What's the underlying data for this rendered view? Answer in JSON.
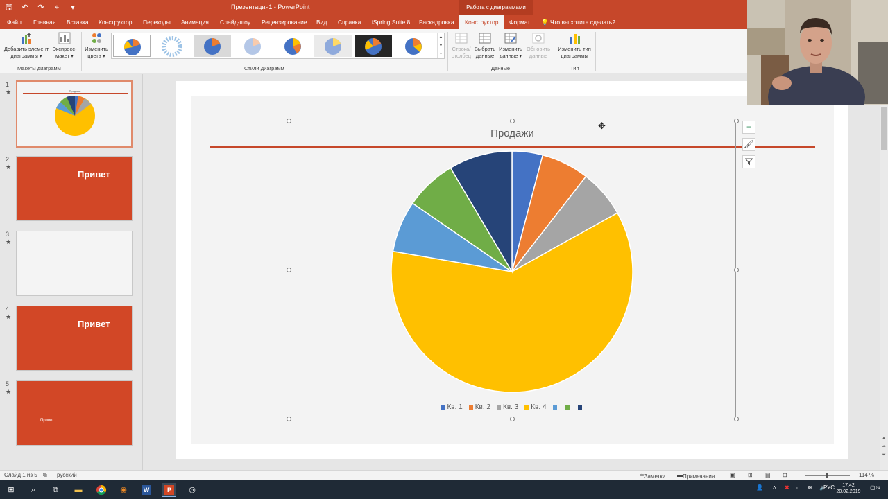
{
  "window": {
    "title": "Презентация1  -  PowerPoint",
    "context_group": "Работа с диаграммами",
    "qat_icons": [
      "save-icon",
      "undo-icon",
      "redo-icon",
      "touch-mode-icon",
      "customize-icon"
    ]
  },
  "tabs": [
    {
      "label": "Файл"
    },
    {
      "label": "Главная"
    },
    {
      "label": "Вставка"
    },
    {
      "label": "Конструктор"
    },
    {
      "label": "Переходы"
    },
    {
      "label": "Анимация"
    },
    {
      "label": "Слайд-шоу"
    },
    {
      "label": "Рецензирование"
    },
    {
      "label": "Вид"
    },
    {
      "label": "Справка"
    },
    {
      "label": "iSpring Suite 8"
    },
    {
      "label": "Раскадровка"
    },
    {
      "label": "Конструктор"
    },
    {
      "label": "Формат"
    }
  ],
  "tell_me": "Что вы хотите сделать?",
  "ribbon": {
    "add_element": "Добавить элемент диаграммы",
    "add_element_l1": "Добавить элемент",
    "add_element_l2": "диаграммы ▾",
    "quick_layout_l1": "Экспресс-",
    "quick_layout_l2": "макет ▾",
    "change_colors_l1": "Изменить",
    "change_colors_l2": "цвета ▾",
    "group_layouts": "Макеты диаграмм",
    "group_styles": "Стили диаграмм",
    "switch_row_l1": "Строка/",
    "switch_row_l2": "столбец",
    "select_data_l1": "Выбрать",
    "select_data_l2": "данные",
    "edit_data_l1": "Изменить",
    "edit_data_l2": "данные ▾",
    "refresh_data_l1": "Обновить",
    "refresh_data_l2": "данные",
    "group_data": "Данные",
    "change_type_l1": "Изменить тип",
    "change_type_l2": "диаграммы",
    "group_type": "Тип"
  },
  "slides": [
    {
      "num": "1",
      "star": "★",
      "text": ""
    },
    {
      "num": "2",
      "star": "★",
      "text": "Привет"
    },
    {
      "num": "3",
      "star": "★",
      "text": ""
    },
    {
      "num": "4",
      "star": "★",
      "text": "Привет"
    },
    {
      "num": "5",
      "star": "★",
      "text": "Привет"
    }
  ],
  "thumb1_title": "Продажи",
  "colors": {
    "accent": "#c6472a",
    "slide_red": "#d24726",
    "series": [
      "#4472c4",
      "#ed7d31",
      "#a5a5a5",
      "#ffc000",
      "#5b9bd5",
      "#70ad47",
      "#264478"
    ]
  },
  "chart_data": {
    "type": "pie",
    "title": "Продажи",
    "categories": [
      "Кв. 1",
      "Кв. 2",
      "Кв. 3",
      "Кв. 4",
      "",
      "",
      ""
    ],
    "values": [
      4.1,
      6.4,
      6.4,
      60.8,
      6.9,
      6.9,
      8.5
    ],
    "legend": "bottom"
  },
  "status": {
    "slide_count": "Слайд 1 из 5",
    "language": "русский",
    "notes": "Заметки",
    "comments": "Примечания",
    "zoom": "114 %"
  },
  "taskbar": {
    "language": "РУС",
    "time": "17:42",
    "date": "20.02.2019",
    "notifications": "24"
  }
}
